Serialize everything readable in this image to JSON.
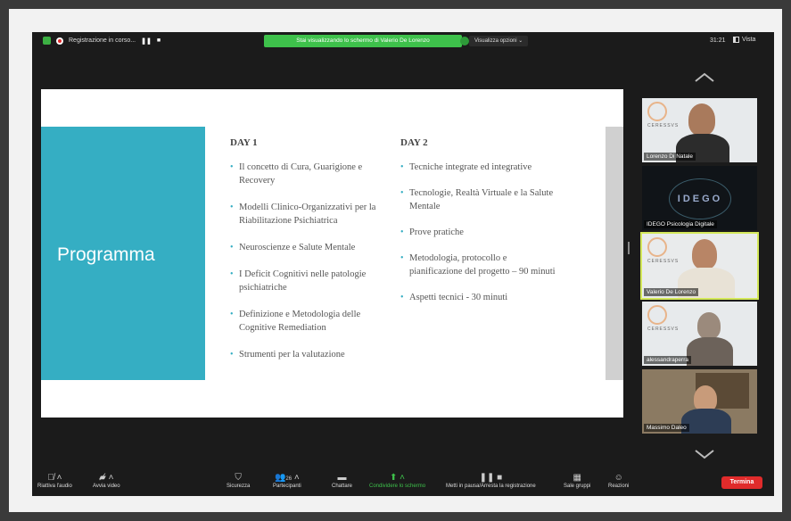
{
  "topbar": {
    "recording_label": "Registrazione in corso...",
    "pause_icon": "pause-icon",
    "stop_icon": "stop-icon",
    "share_banner": "Stai visualizzando lo schermo di Valerio De Lorenzo",
    "view_options": "Visualizza opzioni ⌄",
    "clock": "31:21",
    "view_label": "Vista"
  },
  "slide": {
    "title": "Programma",
    "day1": {
      "heading": "DAY 1",
      "items": [
        "Il concetto di Cura, Guarigione e Recovery",
        "Modelli Clinico-Organizzativi per la Riabilitazione Psichiatrica",
        "Neuroscienze e Salute Mentale",
        "I Deficit Cognitivi nelle patologie psichiatriche",
        "Definizione e Metodologia delle Cognitive Remediation",
        "Strumenti per la valutazione"
      ]
    },
    "day2": {
      "heading": "DAY 2",
      "items": [
        "Tecniche integrate ed integrative",
        "Tecnologie, Realtà Virtuale e la Salute Mentale",
        "Prove pratiche",
        "Metodologia, protocollo e pianificazione del progetto – 90 minuti",
        "Aspetti tecnici - 30 minuti"
      ]
    }
  },
  "participants": [
    {
      "name": "Lorenzo Di Natale",
      "logo_text": "CERESSVS"
    },
    {
      "name": "IDEGO Psicologia Digitale",
      "logo_text": "IDEGO"
    },
    {
      "name": "Valerio De Lorenzo",
      "logo_text": "CERESSVS"
    },
    {
      "name": "alessandraperra",
      "logo_text": "CERESSVS"
    },
    {
      "name": "Massimo Daleo",
      "logo_text": ""
    }
  ],
  "toolbar": {
    "audio": "Riattiva l'audio",
    "video": "Avvia video",
    "security": "Sicurezza",
    "participants": "Partecipanti",
    "participants_count": "26",
    "chat": "Chattare",
    "share": "Condividere lo schermo",
    "record": "Metti in pausa/Arresta la registrazione",
    "rooms": "Sale gruppi",
    "reactions": "Reazioni",
    "end": "Termina"
  },
  "colors": {
    "accent_green": "#3ec14b",
    "slide_panel": "#35aec3",
    "end_red": "#e02b2b",
    "active_outline": "#d4e85a"
  }
}
